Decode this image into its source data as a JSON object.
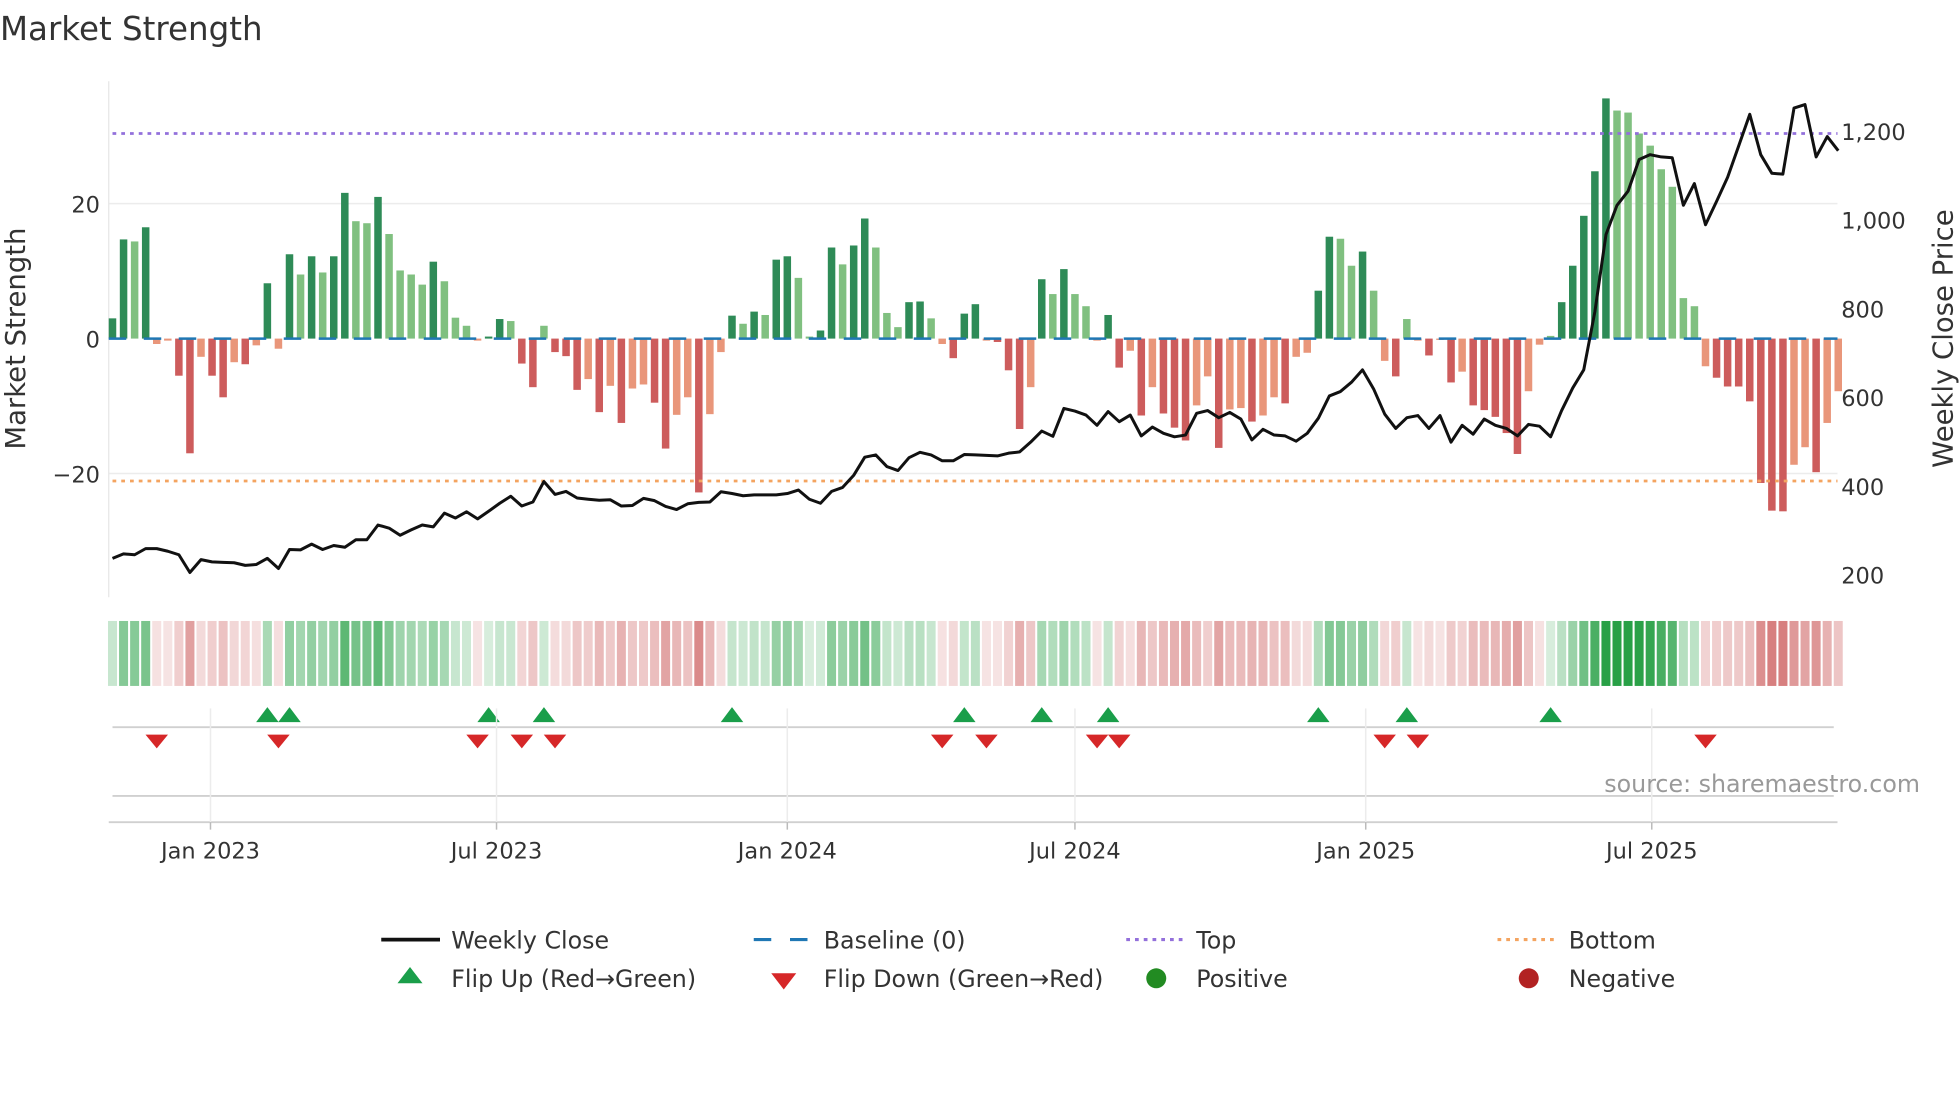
{
  "title": "Market Strength",
  "source": "source: sharemaestro.com",
  "colors": {
    "pos_strong": "#2e8b57",
    "pos_weak": "#80c080",
    "neg_strong": "#cd5c5c",
    "neg_weak": "#e9967a",
    "baseline": "#1f77b4",
    "top": "#9370db",
    "bottom": "#f4a460",
    "close": "#111111",
    "flip_up": "#1a9e4a",
    "flip_down": "#d62728",
    "positive": "#228b22",
    "negative": "#b22222"
  },
  "legend": {
    "weekly_close": "Weekly Close",
    "baseline": "Baseline (0)",
    "top": "Top",
    "bottom": "Bottom",
    "flip_up": "Flip Up (Red→Green)",
    "flip_down": "Flip Down (Green→Red)",
    "positive": "Positive",
    "negative": "Negative"
  },
  "chart_data": {
    "type": "bar",
    "title": "Market Strength",
    "ylabel": "Market Strength",
    "y2label": "Weekly Close Price",
    "frequency": "weekly",
    "start_date": "2022-10-31",
    "ylim": [
      -38,
      38.5
    ],
    "y2lim": [
      140,
      1330
    ],
    "y_ticks": [
      {
        "value": 20,
        "label": "20"
      },
      {
        "value": 0,
        "label": "0"
      },
      {
        "value": -20,
        "label": "−20"
      }
    ],
    "y2_ticks": [
      {
        "value": 1200,
        "label": "1,200"
      },
      {
        "value": 1000,
        "label": "1,000"
      },
      {
        "value": 800,
        "label": "800"
      },
      {
        "value": 600,
        "label": "600"
      },
      {
        "value": 400,
        "label": "400"
      },
      {
        "value": 200,
        "label": "200"
      }
    ],
    "x_ticks": [
      {
        "date": "2023-01-01",
        "label": "Jan 2023"
      },
      {
        "date": "2023-07-01",
        "label": "Jul 2023"
      },
      {
        "date": "2024-01-01",
        "label": "Jan 2024"
      },
      {
        "date": "2024-07-01",
        "label": "Jul 2024"
      },
      {
        "date": "2025-01-01",
        "label": "Jan 2025"
      },
      {
        "date": "2025-07-01",
        "label": "Jul 2025"
      }
    ],
    "top_level": 30.4,
    "bottom_level": -21.1,
    "baseline": 0,
    "strength": [
      3,
      14.7,
      14.4,
      16.5,
      -0.8,
      -0.3,
      -5.5,
      -17,
      -2.7,
      -5.5,
      -8.7,
      -3.5,
      -3.8,
      -1,
      8.2,
      -1.5,
      12.5,
      9.5,
      12.2,
      9.8,
      12.2,
      21.6,
      17.4,
      17.1,
      21.0,
      15.5,
      10.1,
      9.5,
      8,
      11.4,
      8.5,
      3.1,
      1.9,
      -0.3,
      0.3,
      2.9,
      2.6,
      -3.7,
      -7.2,
      1.9,
      -2,
      -2.6,
      -7.6,
      -6,
      -10.9,
      -7,
      -12.5,
      -7.4,
      -6.8,
      -9.5,
      -16.3,
      -11.3,
      -8.7,
      -22.8,
      -11.2,
      -2,
      3.4,
      2.2,
      4,
      3.5,
      11.7,
      12.2,
      9,
      0.3,
      1.2,
      13.5,
      11,
      13.8,
      17.8,
      13.5,
      3.8,
      1.7,
      5.4,
      5.5,
      3,
      -0.8,
      -2.9,
      3.7,
      5.1,
      -0.3,
      -0.5,
      -4.7,
      -13.4,
      -7.2,
      8.8,
      6.6,
      10.3,
      6.6,
      4.8,
      -0.3,
      3.5,
      -4.3,
      -1.8,
      -11.4,
      -7.2,
      -11.1,
      -13.2,
      -15.1,
      -9.9,
      -5.6,
      -16.2,
      -10.5,
      -10.3,
      -12.3,
      -11.4,
      -8.7,
      -9.6,
      -2.7,
      -2.1,
      7.1,
      15.1,
      14.8,
      10.8,
      12.9,
      7.1,
      -3.3,
      -5.6,
      2.9,
      -0.3,
      -2.5,
      -0.2,
      -6.5,
      -4.9,
      -9.9,
      -10.6,
      -11.6,
      -14,
      -17.1,
      -7.8,
      -0.9,
      0.4,
      5.4,
      10.8,
      18.2,
      24.8,
      35.6,
      33.8,
      33.5,
      30.4,
      28.6,
      25.1,
      22.5,
      6,
      4.8,
      -4.1,
      -5.8,
      -7.1,
      -7.1,
      -9.3,
      -21.4,
      -25.5,
      -25.6,
      -18.7,
      -16.1,
      -19.8,
      -12.5,
      -7.8
    ],
    "weekly_close": [
      237,
      247,
      245,
      259,
      259,
      253,
      245,
      205,
      234,
      229,
      228,
      227,
      221,
      223,
      237,
      214,
      257,
      256,
      269,
      257,
      266,
      262,
      279,
      279,
      312,
      305,
      289,
      301,
      312,
      308,
      339,
      328,
      342,
      326,
      343,
      361,
      377,
      355,
      364,
      410,
      381,
      388,
      373,
      370,
      368,
      369,
      355,
      356,
      372,
      367,
      354,
      347,
      360,
      363,
      364,
      387,
      383,
      378,
      380,
      380,
      380,
      383,
      391,
      370,
      361,
      388,
      397,
      424,
      465,
      470,
      444,
      435,
      464,
      476,
      470,
      457,
      457,
      471,
      470,
      469,
      468,
      474,
      477,
      499,
      524,
      512,
      575,
      569,
      560,
      537,
      568,
      545,
      560,
      513,
      533,
      519,
      511,
      515,
      564,
      570,
      554,
      566,
      551,
      504,
      528,
      515,
      513,
      501,
      519,
      553,
      603,
      613,
      634,
      662,
      619,
      562,
      530,
      554,
      559,
      530,
      559,
      499,
      537,
      517,
      551,
      537,
      530,
      513,
      539,
      535,
      511,
      570,
      621,
      662,
      793,
      967,
      1033,
      1065,
      1136,
      1147,
      1142,
      1140,
      1033,
      1082,
      989,
      1042,
      1096,
      1167,
      1238,
      1147,
      1105,
      1103,
      1252,
      1260,
      1142,
      1188,
      1156
    ],
    "flip_up_weeks": [
      14,
      16,
      34,
      39,
      56,
      77,
      84,
      90,
      109,
      117,
      130
    ],
    "flip_down_weeks": [
      4,
      15,
      33,
      37,
      40,
      75,
      79,
      89,
      91,
      115,
      118,
      144
    ]
  }
}
